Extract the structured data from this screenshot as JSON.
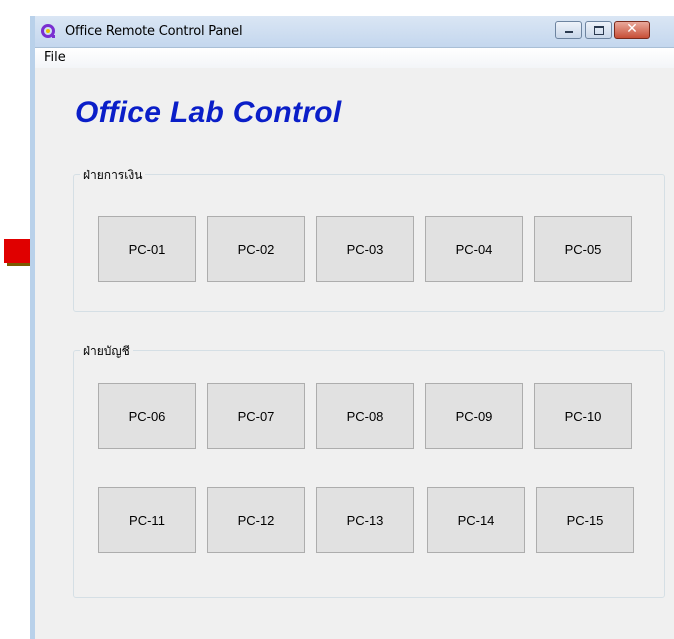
{
  "window": {
    "title": "Office Remote Control Panel",
    "controls": {
      "close_label": "✕"
    }
  },
  "menu": {
    "file_label": "File"
  },
  "app_title": "Office Lab Control",
  "groups": [
    {
      "label": "ฝ่ายการเงิน",
      "buttons": [
        "PC-01",
        "PC-02",
        "PC-03",
        "PC-04",
        "PC-05"
      ]
    },
    {
      "label": "ฝ่ายบัญชี",
      "buttons": [
        "PC-06",
        "PC-07",
        "PC-08",
        "PC-09",
        "PC-10",
        "PC-11",
        "PC-12",
        "PC-13",
        "PC-14",
        "PC-15"
      ]
    }
  ],
  "colors": {
    "app_title": "#0a1ec8",
    "annotation_arrow": "#e00000",
    "button_bg": "#e1e1e1",
    "window_bg": "#f0f0f0"
  },
  "icons": [
    "app-icon",
    "minimize-icon",
    "maximize-icon",
    "close-icon",
    "arrow-annotation-icon"
  ]
}
